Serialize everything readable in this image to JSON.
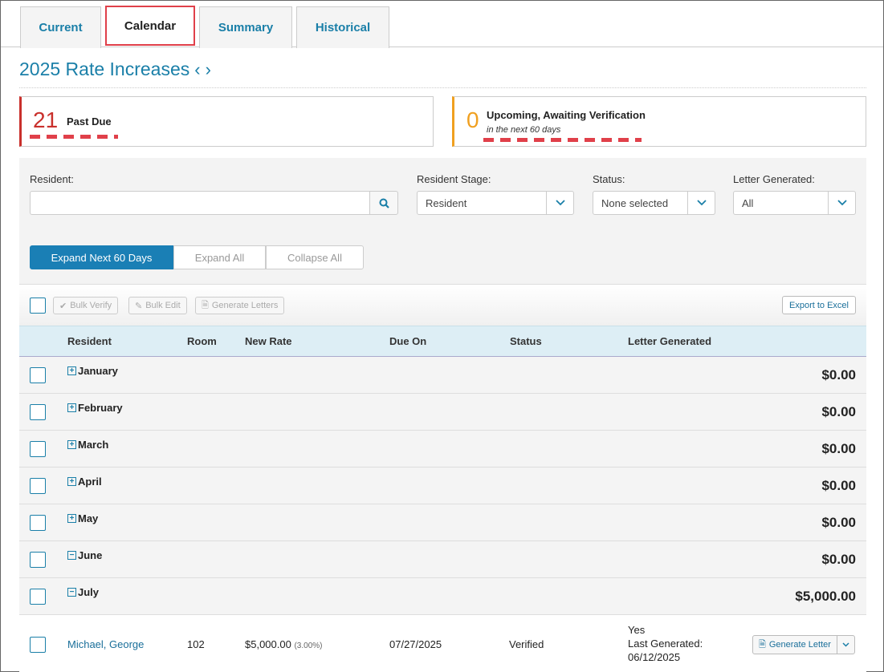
{
  "tabs": [
    {
      "label": "Current",
      "active": false
    },
    {
      "label": "Calendar",
      "active": true
    },
    {
      "label": "Summary",
      "active": false
    },
    {
      "label": "Historical",
      "active": false
    }
  ],
  "header": {
    "title": "2025 Rate Increases",
    "prev": "‹",
    "next": "›"
  },
  "stats": {
    "past_due": {
      "count": "21",
      "label": "Past Due",
      "color": "#c9302c"
    },
    "upcoming": {
      "count": "0",
      "label": "Upcoming, Awaiting Verification",
      "sub": "in the next 60 days",
      "color": "#f0a020"
    }
  },
  "filters": {
    "resident_label": "Resident:",
    "resident_value": "",
    "stage_label": "Resident Stage:",
    "stage_value": "Resident",
    "status_label": "Status:",
    "status_value": "None selected",
    "letter_label": "Letter Generated:",
    "letter_value": "All"
  },
  "expand": {
    "next60": "Expand Next 60 Days",
    "all": "Expand All",
    "collapse": "Collapse All"
  },
  "toolbar": {
    "bulk_verify": "Bulk Verify",
    "bulk_edit": "Bulk Edit",
    "generate_letters": "Generate Letters",
    "export": "Export to Excel"
  },
  "columns": [
    "Resident",
    "Room",
    "New Rate",
    "Due On",
    "Status",
    "Letter Generated"
  ],
  "months": [
    {
      "name": "January",
      "expanded": false,
      "total": "$0.00"
    },
    {
      "name": "February",
      "expanded": false,
      "total": "$0.00"
    },
    {
      "name": "March",
      "expanded": false,
      "total": "$0.00"
    },
    {
      "name": "April",
      "expanded": false,
      "total": "$0.00"
    },
    {
      "name": "May",
      "expanded": false,
      "total": "$0.00"
    },
    {
      "name": "June",
      "expanded": true,
      "total": "$0.00"
    },
    {
      "name": "July",
      "expanded": true,
      "total": "$5,000.00"
    }
  ],
  "rows": [
    {
      "resident": "Michael, George",
      "room": "102",
      "rate": "$5,000.00",
      "rate_pct": "(3.00%)",
      "due_on": "07/27/2025",
      "status": "Verified",
      "letter_yes": "Yes",
      "letter_last": "Last Generated:",
      "letter_date": "06/12/2025",
      "action": "Generate Letter"
    }
  ],
  "colors": {
    "accent": "#1a7fa8",
    "highlight": "#e0404a"
  }
}
